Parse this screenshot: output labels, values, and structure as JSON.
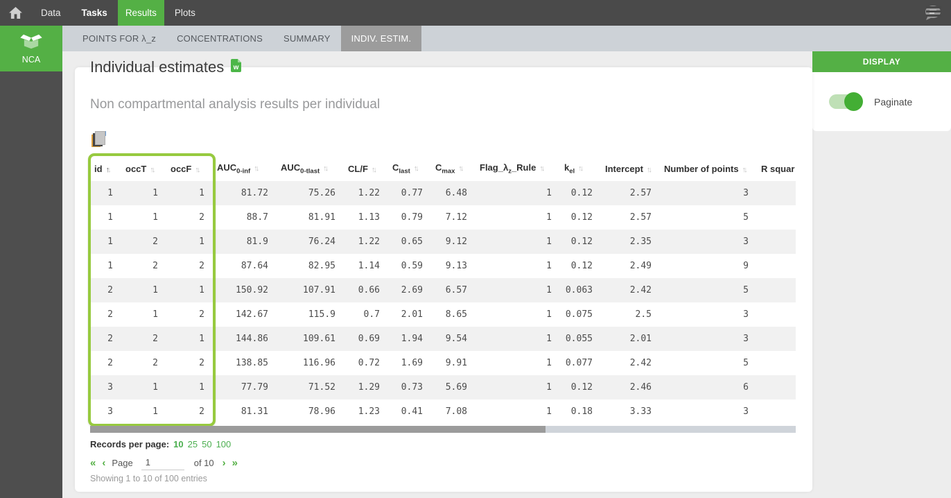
{
  "topnav": {
    "items": [
      {
        "label": "Data",
        "active": false,
        "bold": false
      },
      {
        "label": "Tasks",
        "active": false,
        "bold": true
      },
      {
        "label": "Results",
        "active": true,
        "bold": false
      },
      {
        "label": "Plots",
        "active": false,
        "bold": false
      }
    ]
  },
  "tabbar": {
    "tabs": [
      {
        "label": "POINTS FOR λ_z",
        "active": false
      },
      {
        "label": "CONCENTRATIONS",
        "active": false
      },
      {
        "label": "SUMMARY",
        "active": false
      },
      {
        "label": "INDIV. ESTIM.",
        "active": true
      }
    ]
  },
  "sidebar": {
    "app_label": "NCA"
  },
  "display_panel": {
    "title": "DISPLAY",
    "toggle_label": "Paginate",
    "toggle_on": true
  },
  "main": {
    "title": "Individual estimates",
    "subtitle": "Non compartmental analysis results per individual",
    "table": {
      "columns": [
        {
          "base": "id",
          "sub": "",
          "rest": "",
          "sort": "asc"
        },
        {
          "base": "occT",
          "sub": "",
          "rest": "",
          "sort": "both"
        },
        {
          "base": "occF",
          "sub": "",
          "rest": "",
          "sort": "both"
        },
        {
          "base": "AUC",
          "sub": "0-inf",
          "rest": "",
          "sort": "both"
        },
        {
          "base": "AUC",
          "sub": "0-tlast",
          "rest": "",
          "sort": "both"
        },
        {
          "base": "CL/F",
          "sub": "",
          "rest": "",
          "sort": "both"
        },
        {
          "base": "C",
          "sub": "last",
          "rest": "",
          "sort": "both"
        },
        {
          "base": "C",
          "sub": "max",
          "rest": "",
          "sort": "both"
        },
        {
          "base": "Flag_λ",
          "sub": "z",
          "rest": "_Rule",
          "sort": "both"
        },
        {
          "base": "k",
          "sub": "el",
          "rest": "",
          "sort": "both"
        },
        {
          "base": "Intercept",
          "sub": "",
          "rest": "",
          "sort": "both"
        },
        {
          "base": "Number of points",
          "sub": "",
          "rest": "",
          "sort": "both"
        },
        {
          "base": "R squar",
          "sub": "",
          "rest": "",
          "sort": "none"
        }
      ],
      "rows": [
        [
          "1",
          "1",
          "1",
          "81.72",
          "75.26",
          "1.22",
          "0.77",
          "6.48",
          "1",
          "0.12",
          "2.57",
          "3",
          ""
        ],
        [
          "1",
          "1",
          "2",
          "88.7",
          "81.91",
          "1.13",
          "0.79",
          "7.12",
          "1",
          "0.12",
          "2.57",
          "5",
          ""
        ],
        [
          "1",
          "2",
          "1",
          "81.9",
          "76.24",
          "1.22",
          "0.65",
          "9.12",
          "1",
          "0.12",
          "2.35",
          "3",
          ""
        ],
        [
          "1",
          "2",
          "2",
          "87.64",
          "82.95",
          "1.14",
          "0.59",
          "9.13",
          "1",
          "0.12",
          "2.49",
          "9",
          ""
        ],
        [
          "2",
          "1",
          "1",
          "150.92",
          "107.91",
          "0.66",
          "2.69",
          "6.57",
          "1",
          "0.063",
          "2.42",
          "5",
          ""
        ],
        [
          "2",
          "1",
          "2",
          "142.67",
          "115.9",
          "0.7",
          "2.01",
          "8.65",
          "1",
          "0.075",
          "2.5",
          "3",
          ""
        ],
        [
          "2",
          "2",
          "1",
          "144.86",
          "109.61",
          "0.69",
          "1.94",
          "9.54",
          "1",
          "0.055",
          "2.01",
          "3",
          ""
        ],
        [
          "2",
          "2",
          "2",
          "138.85",
          "116.96",
          "0.72",
          "1.69",
          "9.91",
          "1",
          "0.077",
          "2.42",
          "5",
          ""
        ],
        [
          "3",
          "1",
          "1",
          "77.79",
          "71.52",
          "1.29",
          "0.73",
          "5.69",
          "1",
          "0.12",
          "2.46",
          "6",
          ""
        ],
        [
          "3",
          "1",
          "2",
          "81.31",
          "78.96",
          "1.23",
          "0.41",
          "7.08",
          "1",
          "0.18",
          "3.33",
          "3",
          ""
        ]
      ]
    },
    "pagination": {
      "records_label": "Records per page:",
      "options": [
        "10",
        "25",
        "50",
        "100"
      ],
      "selected_option": "10",
      "first_icon": "«",
      "prev_icon": "‹",
      "page_label": "Page",
      "page_value": "1",
      "of_label": "of 10",
      "next_icon": "›",
      "last_icon": "»",
      "showing": "Showing 1 to 10 of 100 entries"
    }
  },
  "colors": {
    "accent_green": "#54b045",
    "highlight_green": "#97ca3f",
    "link_green": "#4caf50"
  }
}
